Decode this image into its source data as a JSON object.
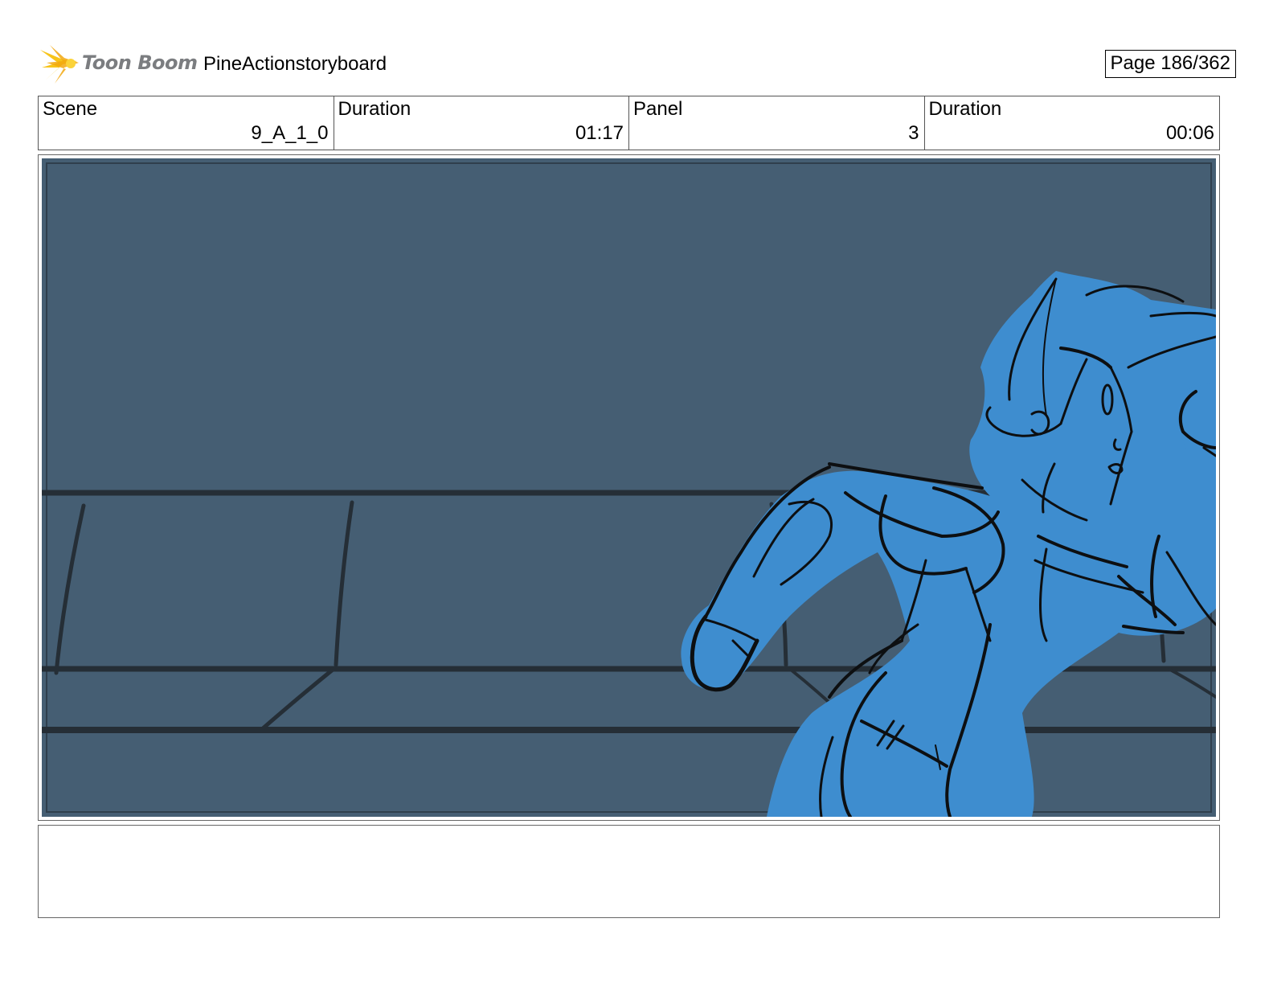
{
  "header": {
    "logo_text": "Toon Boom",
    "project_title": "PineActionstoryboard",
    "page": "Page 186/362"
  },
  "info": {
    "scene_label": "Scene",
    "scene_value": "9_A_1_0",
    "scene_duration_label": "Duration",
    "scene_duration_value": "01:17",
    "panel_label": "Panel",
    "panel_value": "3",
    "panel_duration_label": "Duration",
    "panel_duration_value": "00:06"
  },
  "colors": {
    "background": "#455e73",
    "character_fill": "#3e8dcf",
    "line_dark": "#242d35",
    "logo_yellow": "#f7c41a"
  },
  "notes": {
    "text": ""
  }
}
